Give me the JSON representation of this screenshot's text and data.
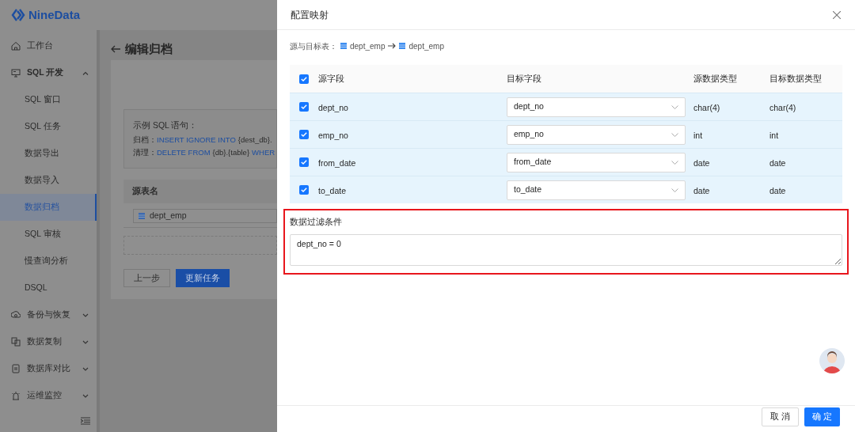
{
  "app": {
    "logo": "NineData"
  },
  "sidebar": {
    "items": [
      {
        "label": "工作台",
        "kind": "link"
      },
      {
        "label": "SQL 开发",
        "kind": "group",
        "expanded": true,
        "children": [
          {
            "label": "SQL 窗口",
            "selected": false
          },
          {
            "label": "SQL 任务",
            "selected": false
          },
          {
            "label": "数据导出",
            "selected": false
          },
          {
            "label": "数据导入",
            "selected": false
          },
          {
            "label": "数据归档",
            "selected": true
          },
          {
            "label": "SQL 审核",
            "selected": false
          },
          {
            "label": "慢查询分析",
            "selected": false
          },
          {
            "label": "DSQL",
            "selected": false
          }
        ]
      },
      {
        "label": "备份与恢复",
        "kind": "group",
        "expanded": false
      },
      {
        "label": "数据复制",
        "kind": "group",
        "expanded": false
      },
      {
        "label": "数据库对比",
        "kind": "group",
        "expanded": false
      },
      {
        "label": "运维监控",
        "kind": "group",
        "expanded": false
      }
    ]
  },
  "page": {
    "title": "编辑归档",
    "sample": {
      "title": "示例 SQL 语句：",
      "lines": [
        {
          "label": "归档：",
          "parts": [
            {
              "text": "INSERT IGNORE INTO",
              "kind": "keyword"
            },
            {
              "text": "{dest_db}.",
              "kind": "plain"
            }
          ]
        },
        {
          "label": "清理：",
          "parts": [
            {
              "text": "DELETE FROM",
              "kind": "keyword"
            },
            {
              "text": "{db}.{table}",
              "kind": "plain"
            },
            {
              "text": "WHER",
              "kind": "keyword"
            }
          ]
        }
      ]
    },
    "source_table": {
      "label": "源表名",
      "value": "dept_emp"
    },
    "buttons": [
      {
        "label": "上一步",
        "kind": "default"
      },
      {
        "label": "更新任务",
        "kind": "primary"
      }
    ]
  },
  "dialog": {
    "title": "配置映射",
    "tables_label": "源与目标表：",
    "source_table": "dept_emp",
    "target_table": "dept_emp",
    "columns": [
      "源字段",
      "目标字段",
      "源数据类型",
      "目标数据类型"
    ],
    "all_checked": true,
    "rows": [
      {
        "checked": true,
        "source": "dept_no",
        "target": "dept_no",
        "source_type": "char(4)",
        "target_type": "char(4)"
      },
      {
        "checked": true,
        "source": "emp_no",
        "target": "emp_no",
        "source_type": "int",
        "target_type": "int"
      },
      {
        "checked": true,
        "source": "from_date",
        "target": "from_date",
        "source_type": "date",
        "target_type": "date"
      },
      {
        "checked": true,
        "source": "to_date",
        "target": "to_date",
        "source_type": "date",
        "target_type": "date"
      }
    ],
    "filter": {
      "label": "数据过滤条件",
      "value": "dept_no = 0"
    },
    "buttons": [
      {
        "label": "取 消",
        "kind": "default"
      },
      {
        "label": "确 定",
        "kind": "primary"
      }
    ]
  }
}
